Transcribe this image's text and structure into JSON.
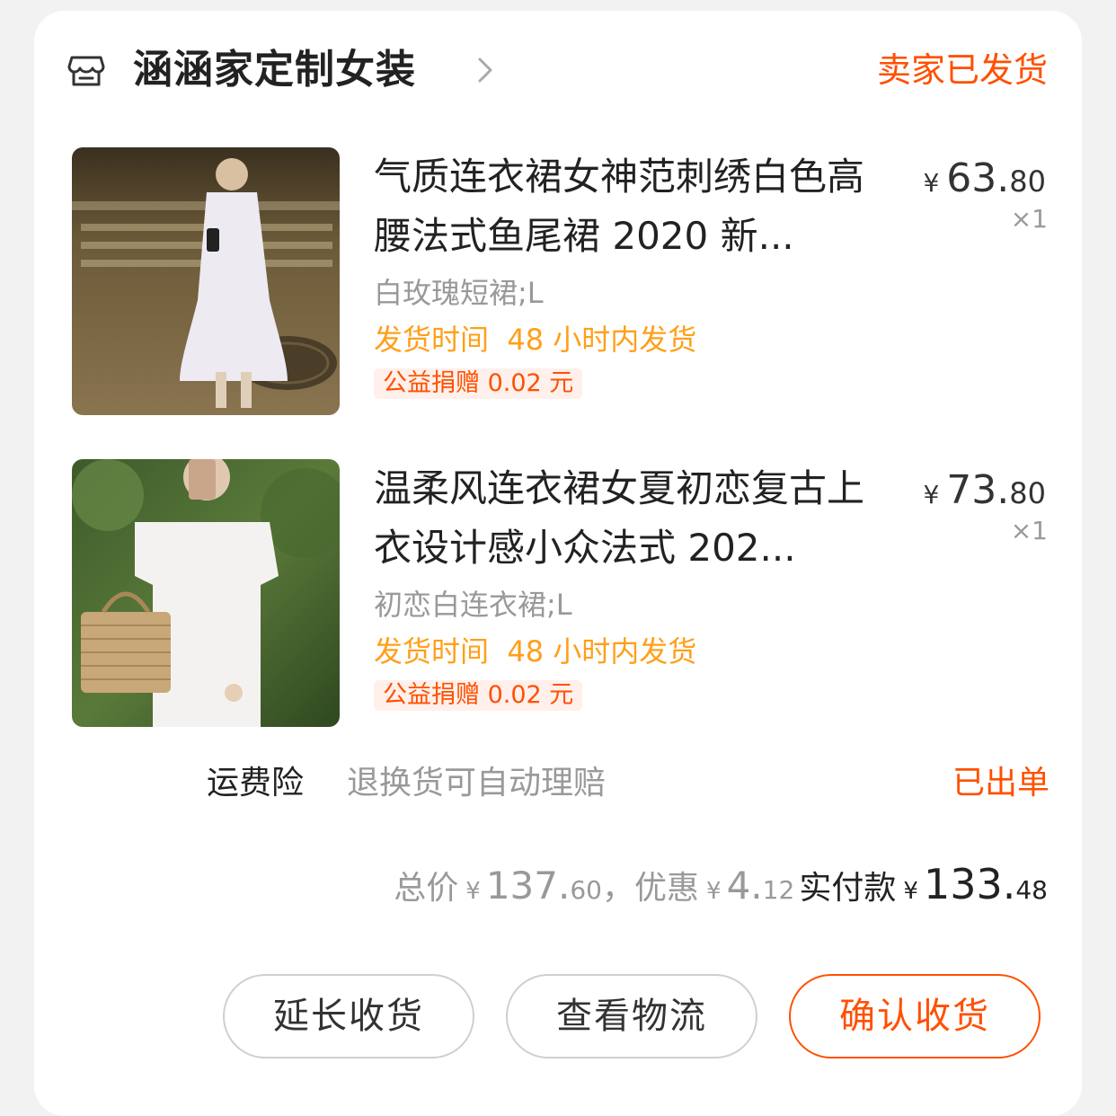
{
  "shop": {
    "name": "涵涵家定制女装",
    "status": "卖家已发货"
  },
  "items": [
    {
      "title": "气质连衣裙女神范刺绣白色高腰法式鱼尾裙 2020 新...",
      "sku": "白玫瑰短裙;L",
      "shipping": "发货时间  48 小时内发货",
      "charity": "公益捐赠 0.02 元",
      "price_currency": "¥",
      "price_int": "63.",
      "price_dec": "80",
      "qty": "×1"
    },
    {
      "title": "温柔风连衣裙女夏初恋复古上衣设计感小众法式 202...",
      "sku": "初恋白连衣裙;L",
      "shipping": "发货时间  48 小时内发货",
      "charity": "公益捐赠 0.02 元",
      "price_currency": "¥",
      "price_int": "73.",
      "price_dec": "80",
      "qty": "×1"
    }
  ],
  "insurance": {
    "label": "运费险",
    "desc": "退换货可自动理赔",
    "status": "已出单"
  },
  "summary": {
    "total_label": "总价",
    "total_currency": "¥",
    "total_int": "137.",
    "total_dec": "60",
    "separator": "，",
    "discount_label": "优惠",
    "discount_currency": "¥",
    "discount_int": "4.",
    "discount_dec": "12",
    "paid_label": "实付款",
    "paid_currency": "¥",
    "paid_int": "133.",
    "paid_dec": "48"
  },
  "actions": {
    "extend": "延长收货",
    "logistics": "查看物流",
    "confirm": "确认收货"
  },
  "colors": {
    "accent": "#ff5000",
    "shipping": "#ff9f1a",
    "muted": "#999999"
  },
  "icons": {
    "shop": "store-icon",
    "chevron": "chevron-right-icon"
  }
}
